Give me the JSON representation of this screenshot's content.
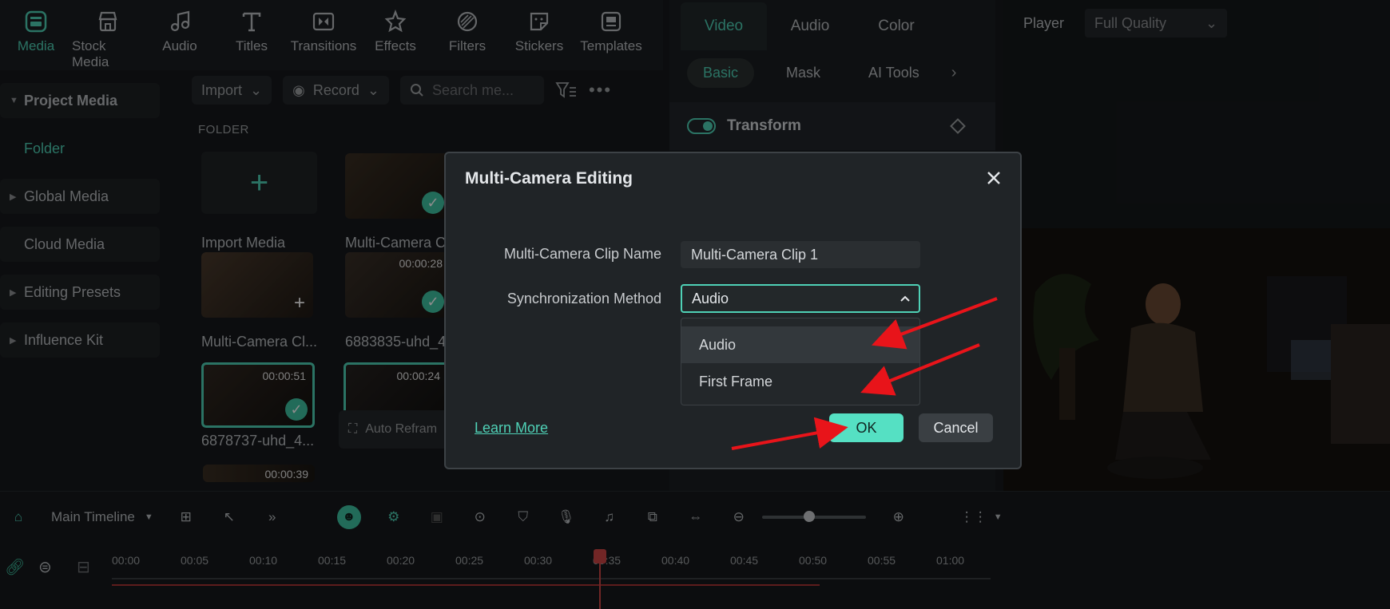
{
  "toolbar": {
    "tabs": [
      {
        "label": "Media",
        "icon": "media-icon"
      },
      {
        "label": "Stock Media",
        "icon": "stock-media-icon"
      },
      {
        "label": "Audio",
        "icon": "music-note-icon"
      },
      {
        "label": "Titles",
        "icon": "text-t-icon"
      },
      {
        "label": "Transitions",
        "icon": "transitions-icon"
      },
      {
        "label": "Effects",
        "icon": "effects-icon"
      },
      {
        "label": "Filters",
        "icon": "filters-icon"
      },
      {
        "label": "Stickers",
        "icon": "stickers-icon"
      },
      {
        "label": "Templates",
        "icon": "templates-icon"
      }
    ]
  },
  "sidebar": {
    "items": [
      {
        "label": "Project Media"
      },
      {
        "label": "Folder"
      },
      {
        "label": "Global Media"
      },
      {
        "label": "Cloud Media"
      },
      {
        "label": "Editing Presets"
      },
      {
        "label": "Influence Kit"
      }
    ]
  },
  "media": {
    "import_label": "Import",
    "record_label": "Record",
    "search_placeholder": "Search me...",
    "folder_label": "FOLDER",
    "import_media_label": "Import Media",
    "clips": [
      {
        "label": "Multi-Camera C",
        "duration": ""
      },
      {
        "label": "Multi-Camera Cl...",
        "duration": ""
      },
      {
        "label": "6883835-uhd_4...",
        "duration": "00:00:28"
      },
      {
        "label": "6878737-uhd_4...",
        "duration": "00:00:51"
      },
      {
        "label": "",
        "duration": "00:00:24"
      },
      {
        "label": "",
        "duration": "00:00:39"
      }
    ],
    "auto_reframe_label": "Auto Refram"
  },
  "props": {
    "tabs": [
      "Video",
      "Audio",
      "Color"
    ],
    "subtabs": [
      "Basic",
      "Mask",
      "AI Tools"
    ],
    "transform_label": "Transform"
  },
  "player": {
    "label": "Player",
    "quality": "Full Quality"
  },
  "timeline": {
    "name": "Main Timeline",
    "ticks": [
      "00:00",
      "00:05",
      "00:10",
      "00:15",
      "00:20",
      "00:25",
      "00:30",
      "00:35",
      "00:40",
      "00:45",
      "00:50",
      "00:55",
      "01:00"
    ]
  },
  "modal": {
    "title": "Multi-Camera Editing",
    "clip_name_label": "Multi-Camera Clip Name",
    "clip_name_value": "Multi-Camera Clip 1",
    "sync_label": "Synchronization Method",
    "sync_value": "Audio",
    "options": [
      "Audio",
      "First Frame"
    ],
    "learn_more": "Learn More",
    "ok_label": "OK",
    "cancel_label": "Cancel"
  },
  "colors": {
    "accent": "#4fd1b6",
    "ok_button": "#55e0c3",
    "annotation_arrow": "#e8141a"
  }
}
